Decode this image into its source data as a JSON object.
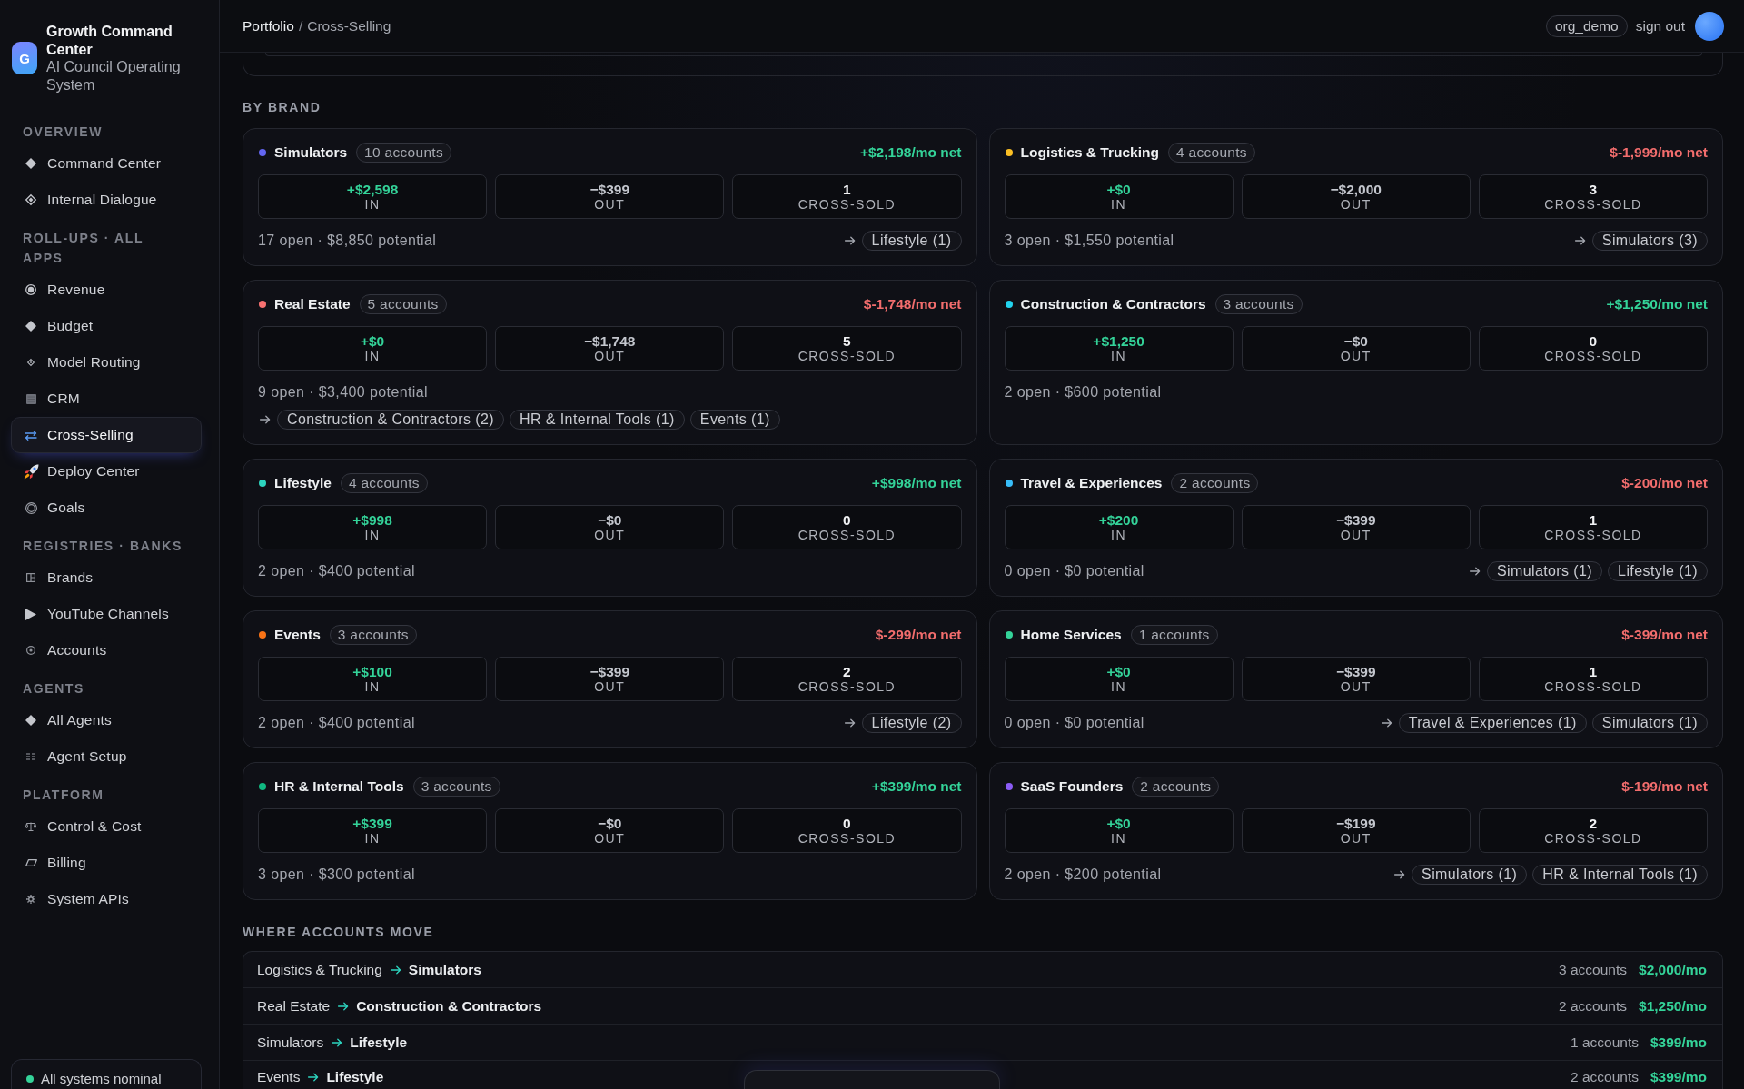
{
  "sidebar": {
    "logo_letter": "G",
    "title": "Growth Command Center",
    "subtitle": "AI Council Operating System",
    "sections": [
      {
        "title": "OVERVIEW",
        "items": [
          {
            "label": "Command Center",
            "selected": false
          },
          {
            "label": "Internal Dialogue",
            "selected": false
          }
        ]
      },
      {
        "title": "ROLL-UPS · ALL APPS",
        "items": [
          {
            "label": "Revenue",
            "selected": false
          },
          {
            "label": "Budget",
            "selected": false
          },
          {
            "label": "Model Routing",
            "selected": false
          },
          {
            "label": "CRM",
            "selected": false
          },
          {
            "label": "Cross-Selling",
            "selected": true
          },
          {
            "label": "Deploy Center",
            "selected": false
          },
          {
            "label": "Goals",
            "selected": false
          }
        ]
      },
      {
        "title": "REGISTRIES · BANKS",
        "items": [
          {
            "label": "Brands",
            "selected": false
          },
          {
            "label": "YouTube Channels",
            "selected": false
          },
          {
            "label": "Accounts",
            "selected": false
          }
        ]
      },
      {
        "title": "AGENTS",
        "items": [
          {
            "label": "All Agents",
            "selected": false
          },
          {
            "label": "Agent Setup",
            "selected": false
          }
        ]
      },
      {
        "title": "PLATFORM",
        "items": [
          {
            "label": "Control & Cost",
            "selected": false
          },
          {
            "label": "Billing",
            "selected": false
          },
          {
            "label": "System APIs",
            "selected": false
          }
        ]
      }
    ],
    "status": "All systems nominal"
  },
  "topbar": {
    "breadcrumb": {
      "items": [
        "Portfolio",
        "Cross-Selling"
      ],
      "separator": "/"
    },
    "org": "org_demo",
    "sign_out": "sign out"
  },
  "by_brand": {
    "title": "BY BRAND",
    "brands": [
      {
        "name": "Simulators",
        "color": "#6366f1",
        "accounts": "10 accounts",
        "net": "+$2,198/mo net",
        "net_positive": true,
        "stats": [
          {
            "kind": "in",
            "value": "+$2,598",
            "label": "IN"
          },
          {
            "kind": "out",
            "value": "−$399",
            "label": "OUT"
          },
          {
            "kind": "cross_sold",
            "value": "1",
            "label": "CROSS-SOLD"
          }
        ],
        "summary": "17 open · $8,850 potential",
        "targets": [
          "Lifestyle (1)"
        ]
      },
      {
        "name": "Logistics & Trucking",
        "color": "#fbbf24",
        "accounts": "4 accounts",
        "net": "$-1,999/mo net",
        "net_positive": false,
        "stats": [
          {
            "kind": "in",
            "value": "+$0",
            "label": "IN"
          },
          {
            "kind": "out",
            "value": "−$2,000",
            "label": "OUT"
          },
          {
            "kind": "cross_sold",
            "value": "3",
            "label": "CROSS-SOLD"
          }
        ],
        "summary": "3 open · $1,550 potential",
        "targets": [
          "Simulators (3)"
        ]
      },
      {
        "name": "Real Estate",
        "color": "#f87171",
        "accounts": "5 accounts",
        "net": "$-1,748/mo net",
        "net_positive": false,
        "stats": [
          {
            "kind": "in",
            "value": "+$0",
            "label": "IN"
          },
          {
            "kind": "out",
            "value": "−$1,748",
            "label": "OUT"
          },
          {
            "kind": "cross_sold",
            "value": "5",
            "label": "CROSS-SOLD"
          }
        ],
        "summary": "9 open · $3,400 potential",
        "targets": [
          "Construction & Contractors (2)",
          "HR & Internal Tools (1)",
          "Events (1)"
        ]
      },
      {
        "name": "Construction & Contractors",
        "color": "#22d3ee",
        "accounts": "3 accounts",
        "net": "+$1,250/mo net",
        "net_positive": true,
        "stats": [
          {
            "kind": "in",
            "value": "+$1,250",
            "label": "IN"
          },
          {
            "kind": "out",
            "value": "−$0",
            "label": "OUT"
          },
          {
            "kind": "cross_sold",
            "value": "0",
            "label": "CROSS-SOLD"
          }
        ],
        "summary": "2 open · $600 potential"
      },
      {
        "name": "Lifestyle",
        "color": "#2dd4bf",
        "accounts": "4 accounts",
        "net": "+$998/mo net",
        "net_positive": true,
        "stats": [
          {
            "kind": "in",
            "value": "+$998",
            "label": "IN"
          },
          {
            "kind": "out",
            "value": "−$0",
            "label": "OUT"
          },
          {
            "kind": "cross_sold",
            "value": "0",
            "label": "CROSS-SOLD"
          }
        ],
        "summary": "2 open · $400 potential"
      },
      {
        "name": "Travel & Experiences",
        "color": "#38bdf8",
        "accounts": "2 accounts",
        "net": "$-200/mo net",
        "net_positive": false,
        "stats": [
          {
            "kind": "in",
            "value": "+$200",
            "label": "IN"
          },
          {
            "kind": "out",
            "value": "−$399",
            "label": "OUT"
          },
          {
            "kind": "cross_sold",
            "value": "1",
            "label": "CROSS-SOLD"
          }
        ],
        "summary": "0 open · $0 potential",
        "targets": [
          "Simulators (1)",
          "Lifestyle (1)"
        ]
      },
      {
        "name": "Events",
        "color": "#f97316",
        "accounts": "3 accounts",
        "net": "$-299/mo net",
        "net_positive": false,
        "stats": [
          {
            "kind": "in",
            "value": "+$100",
            "label": "IN"
          },
          {
            "kind": "out",
            "value": "−$399",
            "label": "OUT"
          },
          {
            "kind": "cross_sold",
            "value": "2",
            "label": "CROSS-SOLD"
          }
        ],
        "summary": "2 open · $400 potential",
        "targets": [
          "Lifestyle (2)"
        ]
      },
      {
        "name": "Home Services",
        "color": "#34d399",
        "accounts": "1 accounts",
        "net": "$-399/mo net",
        "net_positive": false,
        "stats": [
          {
            "kind": "in",
            "value": "+$0",
            "label": "IN"
          },
          {
            "kind": "out",
            "value": "−$399",
            "label": "OUT"
          },
          {
            "kind": "cross_sold",
            "value": "1",
            "label": "CROSS-SOLD"
          }
        ],
        "summary": "0 open · $0 potential",
        "targets": [
          "Travel & Experiences (1)",
          "Simulators (1)"
        ]
      },
      {
        "name": "HR & Internal Tools",
        "color": "#10b981",
        "accounts": "3 accounts",
        "net": "+$399/mo net",
        "net_positive": true,
        "stats": [
          {
            "kind": "in",
            "value": "+$399",
            "label": "IN"
          },
          {
            "kind": "out",
            "value": "−$0",
            "label": "OUT"
          },
          {
            "kind": "cross_sold",
            "value": "0",
            "label": "CROSS-SOLD"
          }
        ],
        "summary": "3 open · $300 potential"
      },
      {
        "name": "SaaS Founders",
        "color": "#8b5cf6",
        "accounts": "2 accounts",
        "net": "$-199/mo net",
        "net_positive": false,
        "stats": [
          {
            "kind": "in",
            "value": "+$0",
            "label": "IN"
          },
          {
            "kind": "out",
            "value": "−$199",
            "label": "OUT"
          },
          {
            "kind": "cross_sold",
            "value": "2",
            "label": "CROSS-SOLD"
          }
        ],
        "summary": "2 open · $200 potential",
        "targets": [
          "Simulators (1)",
          "HR & Internal Tools (1)"
        ]
      }
    ]
  },
  "moves": {
    "title": "WHERE ACCOUNTS MOVE",
    "rows": [
      {
        "from": "Logistics & Trucking",
        "to": "Simulators",
        "accounts": "3 accounts",
        "amount": "$2,000/mo"
      },
      {
        "from": "Real Estate",
        "to": "Construction & Contractors",
        "accounts": "2 accounts",
        "amount": "$1,250/mo"
      },
      {
        "from": "Simulators",
        "to": "Lifestyle",
        "accounts": "1 accounts",
        "amount": "$399/mo"
      },
      {
        "from": "Events",
        "to": "Lifestyle",
        "accounts": "2 accounts",
        "amount": "$399/mo"
      }
    ]
  }
}
